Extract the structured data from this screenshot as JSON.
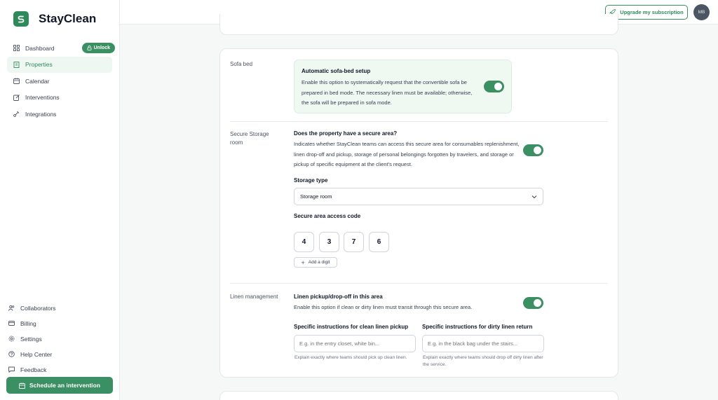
{
  "app": {
    "name": "StayClean"
  },
  "sidebar": {
    "items": [
      {
        "label": "Dashboard",
        "icon": "grid-icon"
      },
      {
        "label": "Properties",
        "icon": "building-icon"
      },
      {
        "label": "Calendar",
        "icon": "calendar-icon"
      },
      {
        "label": "Interventions",
        "icon": "edit-icon"
      },
      {
        "label": "Integrations",
        "icon": "plug-icon"
      }
    ],
    "unlock_label": "Unlock",
    "bottom_items": [
      {
        "label": "Collaborators",
        "icon": "users-icon"
      },
      {
        "label": "Billing",
        "icon": "card-icon"
      },
      {
        "label": "Settings",
        "icon": "gear-icon"
      },
      {
        "label": "Help Center",
        "icon": "help-icon"
      },
      {
        "label": "Feedback",
        "icon": "chat-icon"
      }
    ],
    "schedule_label": "Schedule an intervention"
  },
  "topbar": {
    "upgrade_label": "Upgrade my subscription",
    "avatar_initials": "MB"
  },
  "sofa": {
    "section_label": "Sofa bed",
    "title": "Automatic sofa-bed setup",
    "description": "Enable this option to systematically request that the convertible sofa be prepared in bed mode. The necessary linen must be available; otherwise, the sofa will be prepared in sofa mode.",
    "enabled": true
  },
  "storage": {
    "section_label": "Secure Storage room",
    "question": "Does the property have a secure area?",
    "description": "Indicates whether StayClean teams can access this secure area for consumables replenishment, linen drop-off and pickup, storage of personal belongings forgotten by travelers, and storage or pickup of specific equipment at the client's request.",
    "enabled": true,
    "type_label": "Storage type",
    "type_value": "Storage room",
    "code_label": "Secure area access code",
    "digits": [
      "4",
      "3",
      "7",
      "6"
    ],
    "add_digit_label": "Add a digit"
  },
  "linen": {
    "section_label": "Linen management",
    "title": "Linen pickup/drop-off in this area",
    "description": "Enable this option if clean or dirty linen must transit through this secure area.",
    "enabled": true,
    "clean_label": "Specific instructions for clean linen pickup",
    "clean_placeholder": "E.g. in the entry closet, white bin...",
    "clean_help": "Explain exactly where teams should pick up clean linen.",
    "dirty_label": "Specific instructions for dirty linen return",
    "dirty_placeholder": "E.g. in the black bag under the stairs...",
    "dirty_help": "Explain exactly where teams should drop off dirty linen after the service."
  },
  "colors": {
    "accent": "#3a8f63",
    "accent_light": "#eff8f1"
  }
}
